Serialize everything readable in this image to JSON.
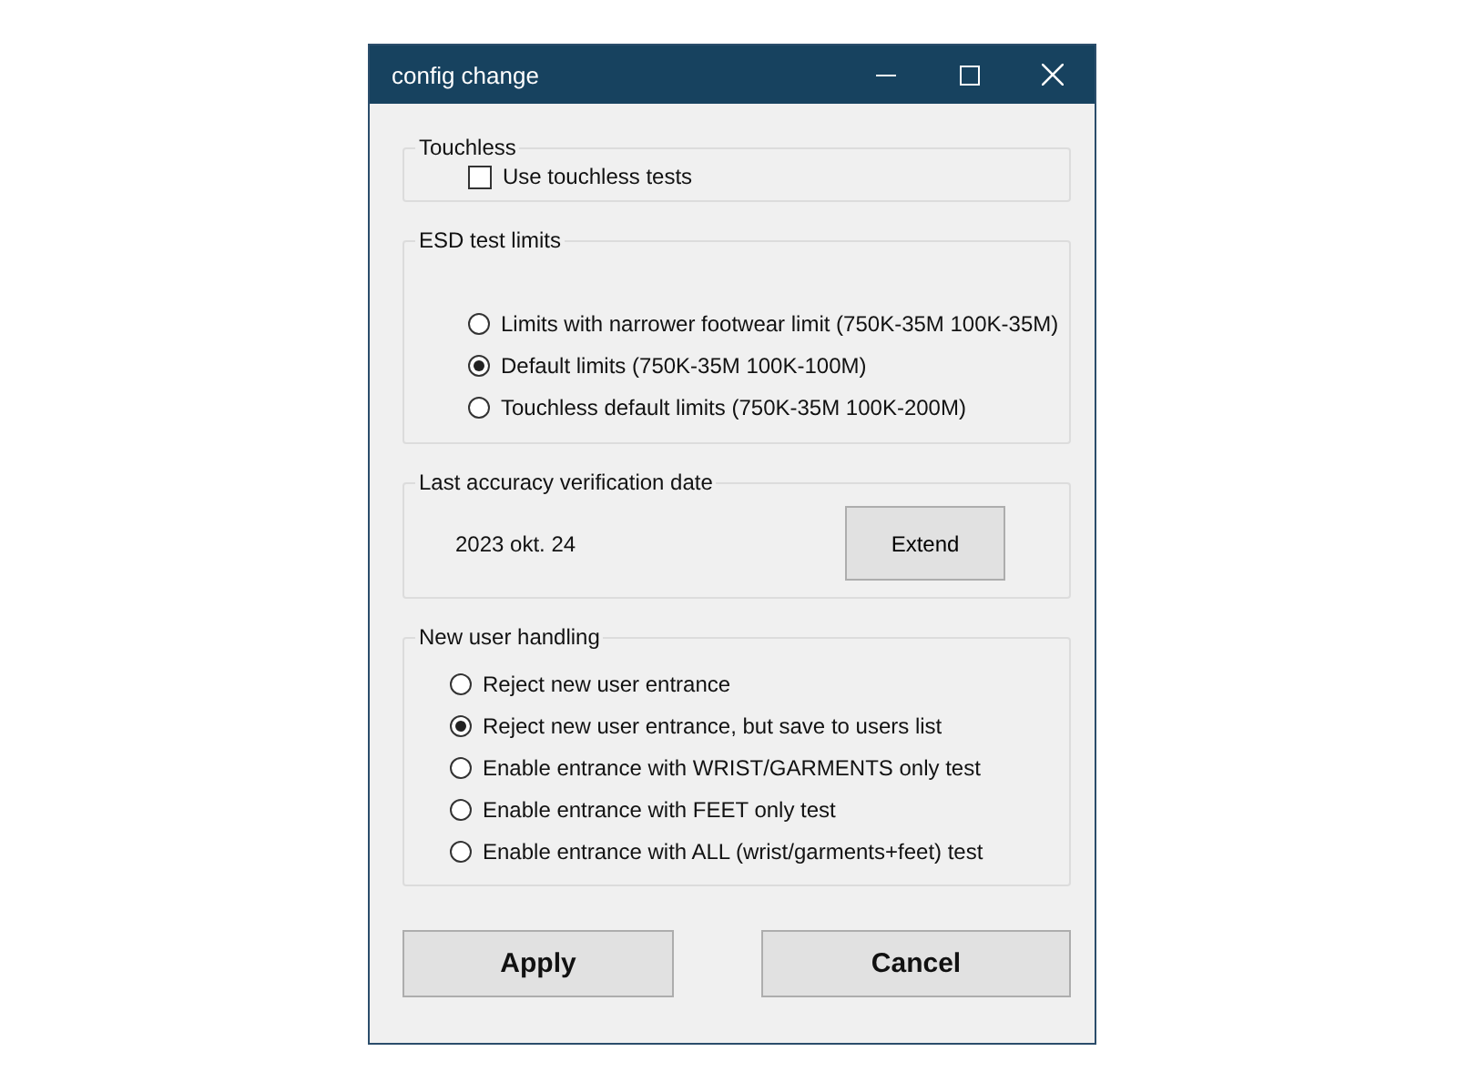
{
  "window": {
    "title": "config change"
  },
  "touchless": {
    "title": "Touchless",
    "checkbox": {
      "label": "Use touchless tests",
      "checked": false
    }
  },
  "esd_test_limits": {
    "title": "ESD test limits",
    "options": [
      {
        "label": "Limits with narrower footwear limit (750K-35M 100K-35M)",
        "selected": false
      },
      {
        "label": "Default limits (750K-35M 100K-100M)",
        "selected": true
      },
      {
        "label": "Touchless default limits (750K-35M 100K-200M)",
        "selected": false
      }
    ]
  },
  "last_accuracy_verification": {
    "title": "Last accuracy verification date",
    "date": "2023 okt. 24",
    "button": "Extend"
  },
  "new_user_handling": {
    "title": "New user handling",
    "options": [
      {
        "label": "Reject new user entrance",
        "selected": false
      },
      {
        "label": "Reject new user entrance, but save to users list",
        "selected": true
      },
      {
        "label": "Enable entrance with WRIST/GARMENTS only test",
        "selected": false
      },
      {
        "label": "Enable entrance with FEET only test",
        "selected": false
      },
      {
        "label": "Enable entrance with ALL (wrist/garments+feet) test",
        "selected": false
      }
    ]
  },
  "buttons": [
    "Apply",
    "Cancel"
  ]
}
